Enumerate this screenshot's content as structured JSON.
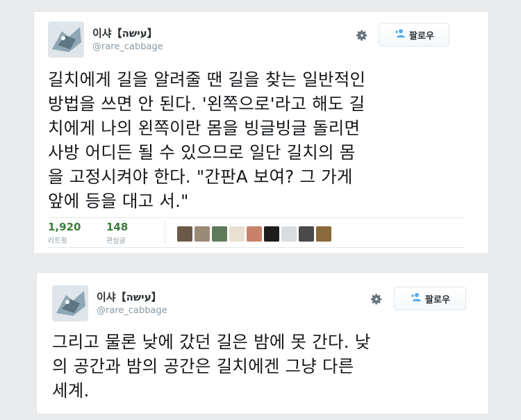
{
  "tweets": [
    {
      "name": "이샤【עישה】",
      "handle": "@rare_cabbage",
      "follow_label": "팔로우",
      "text": "길치에게 길을 알려줄 땐 길을 찾는 일반적인\n방법을 쓰면 안 된다. '왼쪽으로'라고 해도 길\n치에게 나의 왼쪽이란 몸을 빙글빙글 돌리면\n사방 어디든 될 수 있으므로 일단 길치의 몸\n을 고정시켜야 한다. \"간판A 보여? 그 가게\n앞에 등을 대고 서.\"",
      "retweet_count": "1,920",
      "retweet_label": "리트윗",
      "like_count": "148",
      "like_label": "관심글",
      "engager_faces": [
        "#6b5a4a",
        "#9a8a78",
        "#5f7a5a",
        "#e8e0d0",
        "#c9826a",
        "#1d1d1d",
        "#d9dde0",
        "#4a4a4a",
        "#8a6a3a"
      ]
    },
    {
      "name": "이샤【עישה】",
      "handle": "@rare_cabbage",
      "follow_label": "팔로우",
      "text": "그리고 물론 낮에 갔던 길은 밤에 못 간다. 낮\n의 공간과 밤의 공간은 길치에겐 그냥 다른\n세계."
    }
  ],
  "icons": {
    "settings": "gear-icon",
    "follow": "follow-person-icon"
  },
  "colors": {
    "count_green": "#3a7d3a",
    "handle_gray": "#8899a6"
  }
}
